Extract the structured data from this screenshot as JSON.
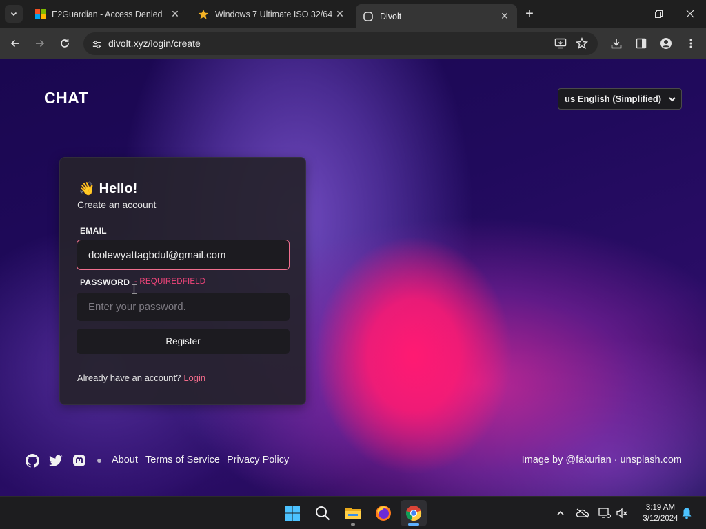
{
  "browser": {
    "tabs": [
      {
        "title": "E2Guardian - Access Denied",
        "icon": "windows-logo-icon",
        "active": false
      },
      {
        "title": "Windows 7 Ultimate ISO 32/64",
        "icon": "star-icon",
        "active": false
      },
      {
        "title": "Divolt",
        "icon": "divolt-icon",
        "active": true
      }
    ],
    "url": "divolt.xyz/login/create"
  },
  "page": {
    "brand": "CHAT",
    "language_select": "us English (Simplified)",
    "card": {
      "greeting": "Hello!",
      "greeting_emoji": "👋",
      "subtitle": "Create an account",
      "email_label": "EMAIL",
      "email_value": "dcolewyattagbdul@gmail.com",
      "password_label": "PASSWORD",
      "password_error": "- REQUIREDFIELD",
      "password_placeholder": "Enter your password.",
      "register_label": "Register",
      "already_text": "Already have an account?",
      "login_link": "Login"
    },
    "footer": {
      "links": [
        "About",
        "Terms of Service",
        "Privacy Policy"
      ],
      "credit": "Image by @fakurian · unsplash.com"
    }
  },
  "taskbar": {
    "apps": [
      "start-icon",
      "search-icon",
      "file-explorer-icon",
      "firefox-icon",
      "chrome-icon"
    ],
    "clock_time": "3:19 AM",
    "clock_date": "3/12/2024"
  },
  "colors": {
    "accent_pink": "#f06b8a",
    "error_red": "#f0457a",
    "card_bg": "#26222c"
  }
}
